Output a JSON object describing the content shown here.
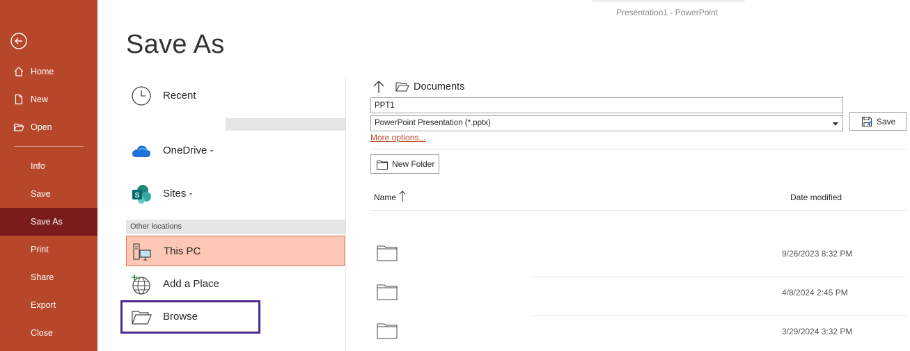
{
  "window": {
    "title": "Presentation1  -  PowerPoint"
  },
  "sidebar": {
    "items": [
      {
        "label": "Home",
        "icon": "home-icon"
      },
      {
        "label": "New",
        "icon": "new-file-icon"
      },
      {
        "label": "Open",
        "icon": "open-folder-icon"
      },
      {
        "label": "Info"
      },
      {
        "label": "Save"
      },
      {
        "label": "Save As",
        "active": true
      },
      {
        "label": "Print"
      },
      {
        "label": "Share"
      },
      {
        "label": "Export"
      },
      {
        "label": "Close"
      }
    ],
    "colors": {
      "background": "#b7472a",
      "active": "#7a1c1c"
    }
  },
  "page": {
    "title": "Save As"
  },
  "locations": {
    "recent": "Recent",
    "onedrive": "OneDrive -",
    "sites": "Sites -",
    "other_header": "Other locations",
    "this_pc": "This PC",
    "add_place": "Add a Place",
    "browse": "Browse"
  },
  "file_pane": {
    "path": "Documents",
    "filename": "PPT1",
    "filetype": "PowerPoint Presentation (*.pptx)",
    "save_label": "Save",
    "more_options": "More options...",
    "new_folder": "New Folder",
    "columns": {
      "name": "Name",
      "date": "Date modified"
    },
    "rows": [
      {
        "date": "9/26/2023 8:32 PM"
      },
      {
        "date": "4/8/2024 2:45 PM"
      },
      {
        "date": "3/29/2024 3:32 PM"
      }
    ]
  }
}
